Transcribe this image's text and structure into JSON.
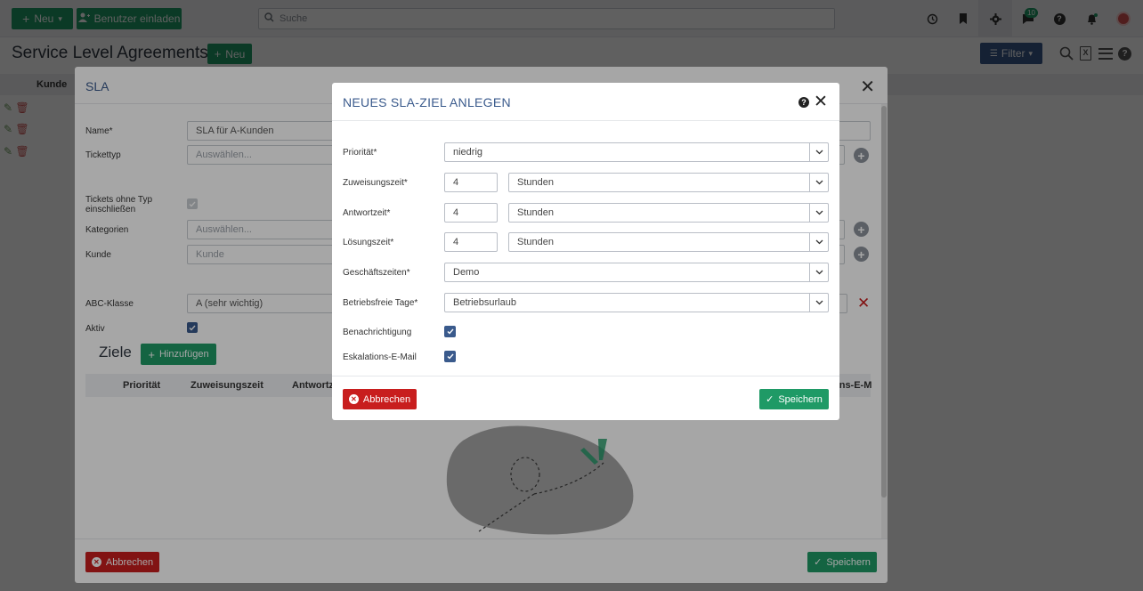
{
  "topbar": {
    "new_label": "Neu",
    "invite_label": "Benutzer einladen",
    "search_placeholder": "Suche",
    "chat_badge": "10",
    "colors": {
      "green": "#1f9a66",
      "blue": "#3a5a8c"
    }
  },
  "page": {
    "title": "Service Level Agreements",
    "new_label": "Neu",
    "filter_label": "Filter",
    "table_col_kunde": "Kunde"
  },
  "sla_modal": {
    "title": "SLA",
    "fields": {
      "name_label": "Name*",
      "name_value": "SLA für A-Kunden",
      "tickettyp_label": "Tickettyp",
      "tickettyp_placeholder": "Auswählen...",
      "ohne_typ_label_1": "Tickets ohne Typ",
      "ohne_typ_label_2": "einschließen",
      "kategorien_label": "Kategorien",
      "kategorien_placeholder": "Auswählen...",
      "kunde_label": "Kunde",
      "kunde_placeholder": "Kunde",
      "abc_label": "ABC-Klasse",
      "abc_value": "A (sehr wichtig)",
      "aktiv_label": "Aktiv"
    },
    "ziele": {
      "title": "Ziele",
      "add_label": "Hinzufügen",
      "columns": [
        "Priorität",
        "Zuweisungszeit",
        "Antwortz",
        "ons-E-M"
      ]
    },
    "cancel_label": "Abbrechen",
    "save_label": "Speichern"
  },
  "ziel_modal": {
    "title": "NEUES SLA-ZIEL ANLEGEN",
    "prioritaet_label": "Priorität*",
    "prioritaet_value": "niedrig",
    "zuweisung_label": "Zuweisungszeit*",
    "zuweisung_value": "4",
    "zuweisung_unit": "Stunden",
    "antwort_label": "Antwortzeit*",
    "antwort_value": "4",
    "antwort_unit": "Stunden",
    "loesung_label": "Lösungszeit*",
    "loesung_value": "4",
    "loesung_unit": "Stunden",
    "geschaeft_label": "Geschäftszeiten*",
    "geschaeft_value": "Demo",
    "betriebsfrei_label": "Betriebsfreie Tage*",
    "betriebsfrei_value": "Betriebsurlaub",
    "benachrichtigung_label": "Benachrichtigung",
    "eskalation_label": "Eskalations-E-Mail",
    "cancel_label": "Abbrechen",
    "save_label": "Speichern"
  }
}
